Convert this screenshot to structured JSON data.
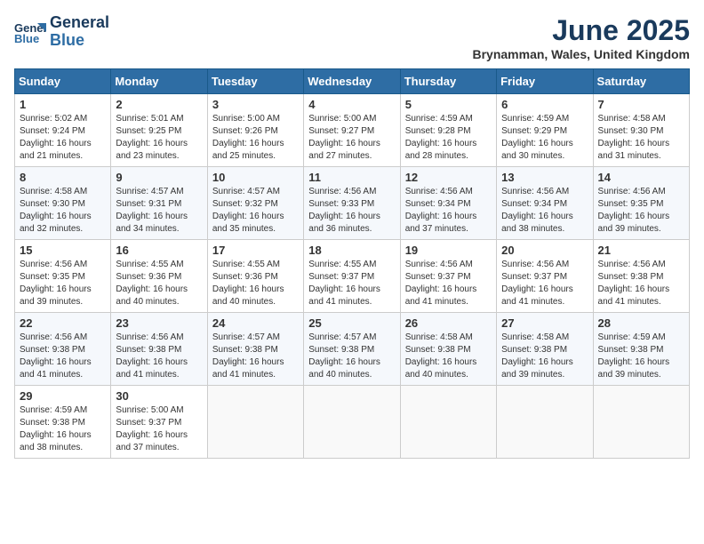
{
  "logo": {
    "line1": "General",
    "line2": "Blue"
  },
  "title": "June 2025",
  "location": "Brynamman, Wales, United Kingdom",
  "days_header": [
    "Sunday",
    "Monday",
    "Tuesday",
    "Wednesday",
    "Thursday",
    "Friday",
    "Saturday"
  ],
  "weeks": [
    [
      {
        "day": "1",
        "rise": "Sunrise: 5:02 AM",
        "set": "Sunset: 9:24 PM",
        "daylight": "Daylight: 16 hours and 21 minutes."
      },
      {
        "day": "2",
        "rise": "Sunrise: 5:01 AM",
        "set": "Sunset: 9:25 PM",
        "daylight": "Daylight: 16 hours and 23 minutes."
      },
      {
        "day": "3",
        "rise": "Sunrise: 5:00 AM",
        "set": "Sunset: 9:26 PM",
        "daylight": "Daylight: 16 hours and 25 minutes."
      },
      {
        "day": "4",
        "rise": "Sunrise: 5:00 AM",
        "set": "Sunset: 9:27 PM",
        "daylight": "Daylight: 16 hours and 27 minutes."
      },
      {
        "day": "5",
        "rise": "Sunrise: 4:59 AM",
        "set": "Sunset: 9:28 PM",
        "daylight": "Daylight: 16 hours and 28 minutes."
      },
      {
        "day": "6",
        "rise": "Sunrise: 4:59 AM",
        "set": "Sunset: 9:29 PM",
        "daylight": "Daylight: 16 hours and 30 minutes."
      },
      {
        "day": "7",
        "rise": "Sunrise: 4:58 AM",
        "set": "Sunset: 9:30 PM",
        "daylight": "Daylight: 16 hours and 31 minutes."
      }
    ],
    [
      {
        "day": "8",
        "rise": "Sunrise: 4:58 AM",
        "set": "Sunset: 9:30 PM",
        "daylight": "Daylight: 16 hours and 32 minutes."
      },
      {
        "day": "9",
        "rise": "Sunrise: 4:57 AM",
        "set": "Sunset: 9:31 PM",
        "daylight": "Daylight: 16 hours and 34 minutes."
      },
      {
        "day": "10",
        "rise": "Sunrise: 4:57 AM",
        "set": "Sunset: 9:32 PM",
        "daylight": "Daylight: 16 hours and 35 minutes."
      },
      {
        "day": "11",
        "rise": "Sunrise: 4:56 AM",
        "set": "Sunset: 9:33 PM",
        "daylight": "Daylight: 16 hours and 36 minutes."
      },
      {
        "day": "12",
        "rise": "Sunrise: 4:56 AM",
        "set": "Sunset: 9:34 PM",
        "daylight": "Daylight: 16 hours and 37 minutes."
      },
      {
        "day": "13",
        "rise": "Sunrise: 4:56 AM",
        "set": "Sunset: 9:34 PM",
        "daylight": "Daylight: 16 hours and 38 minutes."
      },
      {
        "day": "14",
        "rise": "Sunrise: 4:56 AM",
        "set": "Sunset: 9:35 PM",
        "daylight": "Daylight: 16 hours and 39 minutes."
      }
    ],
    [
      {
        "day": "15",
        "rise": "Sunrise: 4:56 AM",
        "set": "Sunset: 9:35 PM",
        "daylight": "Daylight: 16 hours and 39 minutes."
      },
      {
        "day": "16",
        "rise": "Sunrise: 4:55 AM",
        "set": "Sunset: 9:36 PM",
        "daylight": "Daylight: 16 hours and 40 minutes."
      },
      {
        "day": "17",
        "rise": "Sunrise: 4:55 AM",
        "set": "Sunset: 9:36 PM",
        "daylight": "Daylight: 16 hours and 40 minutes."
      },
      {
        "day": "18",
        "rise": "Sunrise: 4:55 AM",
        "set": "Sunset: 9:37 PM",
        "daylight": "Daylight: 16 hours and 41 minutes."
      },
      {
        "day": "19",
        "rise": "Sunrise: 4:56 AM",
        "set": "Sunset: 9:37 PM",
        "daylight": "Daylight: 16 hours and 41 minutes."
      },
      {
        "day": "20",
        "rise": "Sunrise: 4:56 AM",
        "set": "Sunset: 9:37 PM",
        "daylight": "Daylight: 16 hours and 41 minutes."
      },
      {
        "day": "21",
        "rise": "Sunrise: 4:56 AM",
        "set": "Sunset: 9:38 PM",
        "daylight": "Daylight: 16 hours and 41 minutes."
      }
    ],
    [
      {
        "day": "22",
        "rise": "Sunrise: 4:56 AM",
        "set": "Sunset: 9:38 PM",
        "daylight": "Daylight: 16 hours and 41 minutes."
      },
      {
        "day": "23",
        "rise": "Sunrise: 4:56 AM",
        "set": "Sunset: 9:38 PM",
        "daylight": "Daylight: 16 hours and 41 minutes."
      },
      {
        "day": "24",
        "rise": "Sunrise: 4:57 AM",
        "set": "Sunset: 9:38 PM",
        "daylight": "Daylight: 16 hours and 41 minutes."
      },
      {
        "day": "25",
        "rise": "Sunrise: 4:57 AM",
        "set": "Sunset: 9:38 PM",
        "daylight": "Daylight: 16 hours and 40 minutes."
      },
      {
        "day": "26",
        "rise": "Sunrise: 4:58 AM",
        "set": "Sunset: 9:38 PM",
        "daylight": "Daylight: 16 hours and 40 minutes."
      },
      {
        "day": "27",
        "rise": "Sunrise: 4:58 AM",
        "set": "Sunset: 9:38 PM",
        "daylight": "Daylight: 16 hours and 39 minutes."
      },
      {
        "day": "28",
        "rise": "Sunrise: 4:59 AM",
        "set": "Sunset: 9:38 PM",
        "daylight": "Daylight: 16 hours and 39 minutes."
      }
    ],
    [
      {
        "day": "29",
        "rise": "Sunrise: 4:59 AM",
        "set": "Sunset: 9:38 PM",
        "daylight": "Daylight: 16 hours and 38 minutes."
      },
      {
        "day": "30",
        "rise": "Sunrise: 5:00 AM",
        "set": "Sunset: 9:37 PM",
        "daylight": "Daylight: 16 hours and 37 minutes."
      },
      null,
      null,
      null,
      null,
      null
    ]
  ]
}
